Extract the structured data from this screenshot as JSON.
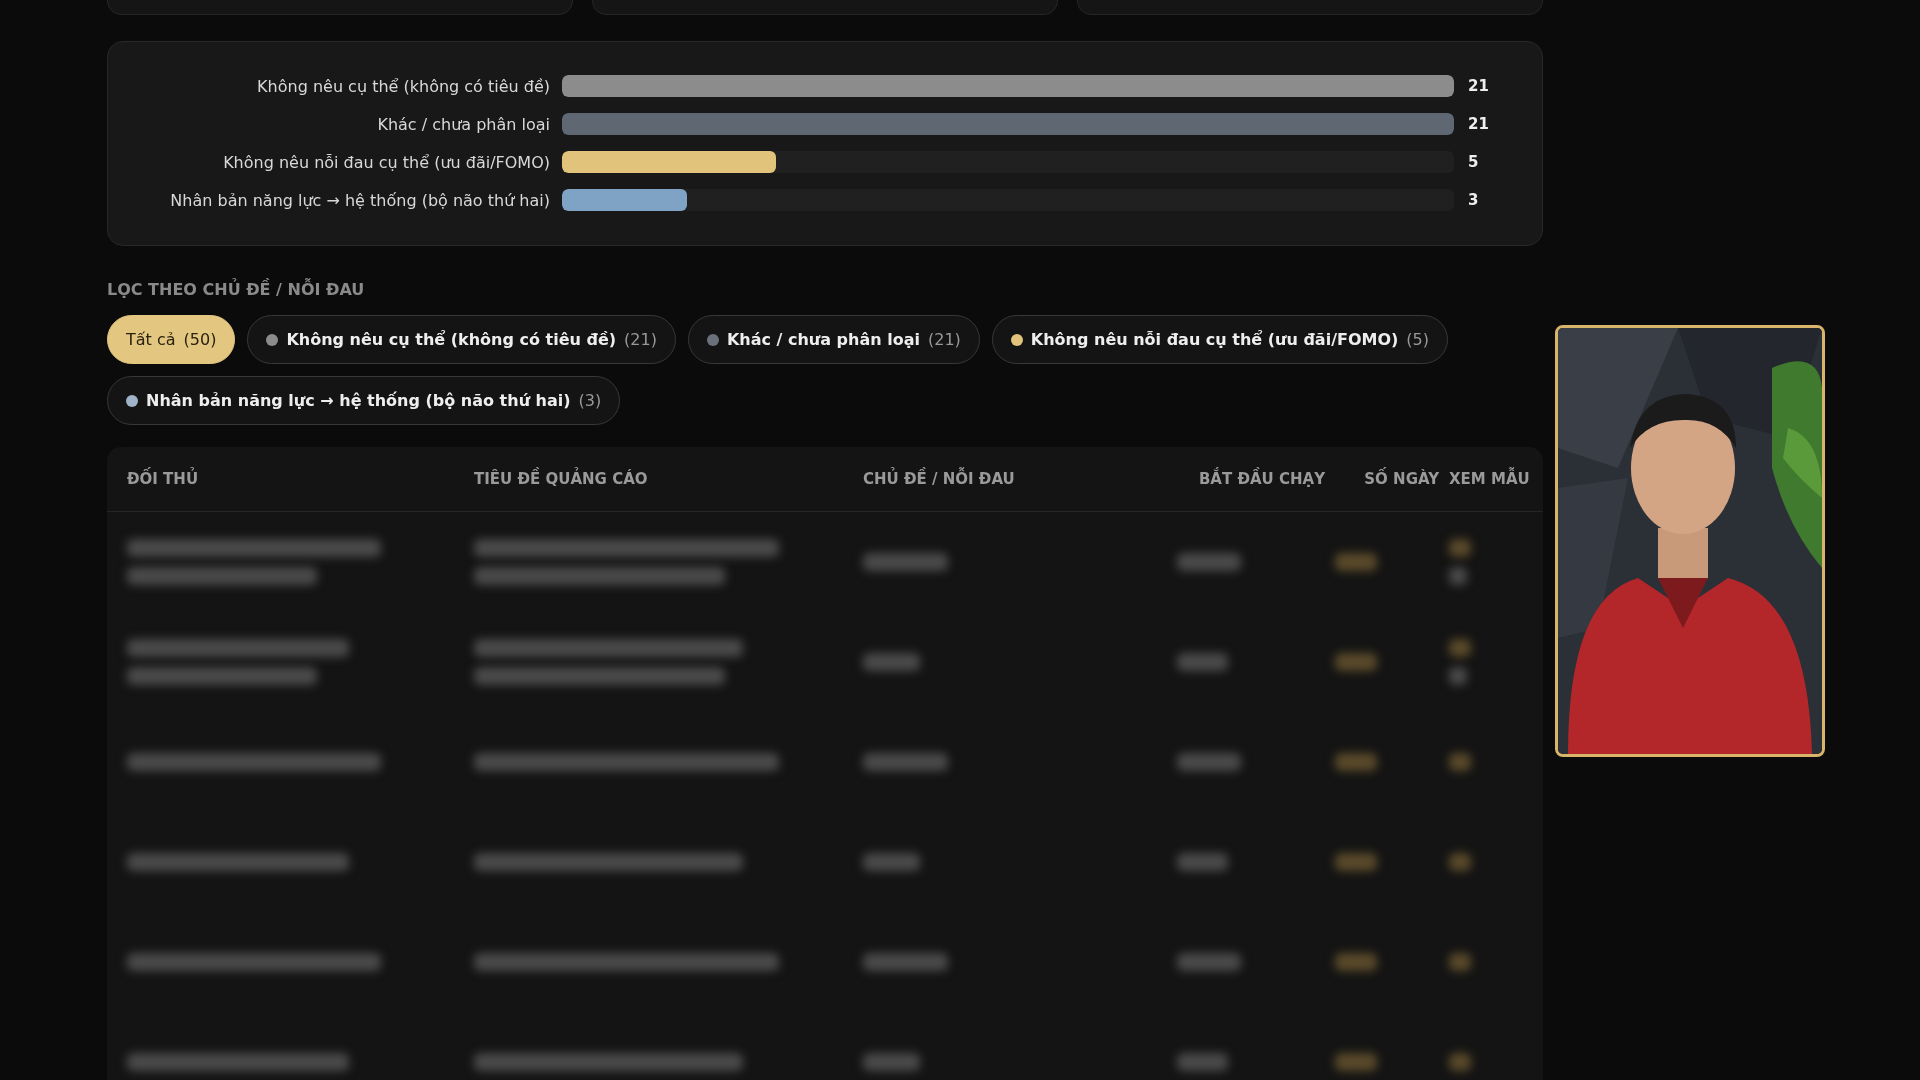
{
  "summary_cards": [
    {
      "kind": "card"
    },
    {
      "kind": "card"
    },
    {
      "kind": "card"
    }
  ],
  "topic_chart": {
    "rows": [
      {
        "label": "Không nêu cụ thể (không có tiêu đề)",
        "level": 1,
        "count": "21",
        "color": "#8c8c8c"
      },
      {
        "label": "Khác / chưa phân loại",
        "level": 1,
        "count": "21",
        "color": "#5f6773"
      },
      {
        "label": "Không nêu nỗi đau cụ thể (ưu đãi/FOMO)",
        "level": 0.24,
        "count": "5",
        "color": "#e2c37c"
      },
      {
        "label": "Nhân bản năng lực → hệ thống (bộ não thứ hai)",
        "level": 0.14,
        "count": "3",
        "color": "#7fa3c4"
      }
    ]
  },
  "filter": {
    "title": "LỌC THEO CHỦ ĐỀ / NỖI ĐAU",
    "chips": [
      {
        "label": "Tất cả",
        "count": "(50)",
        "selected": true
      },
      {
        "label": "Không nêu cụ thể (không có tiêu đề)",
        "count": "(21)",
        "selected": false,
        "color": "#8c8c8c"
      },
      {
        "label": "Khác / chưa phân loại",
        "count": "(21)",
        "selected": false,
        "color": "#6b717a"
      },
      {
        "label": "Không nêu nỗi đau cụ thể (ưu đãi/FOMO)",
        "count": "(5)",
        "selected": false,
        "color": "#e2c37c"
      },
      {
        "label": "Nhân bản năng lực → hệ thống (bộ não thứ hai)",
        "count": "(3)",
        "selected": false,
        "color": "#9fb4c8"
      }
    ]
  },
  "table": {
    "columns": [
      "ĐỐI THỦ",
      "TIÊU ĐỀ QUẢNG CÁO",
      "CHỦ ĐỀ / NỖI ĐAU",
      "BẮT ĐẦU CHẠY",
      "SỐ NGÀY",
      "XEM MẪU"
    ],
    "rows": [
      {
        "kind": "blurred"
      },
      {
        "kind": "blurred"
      },
      {
        "kind": "blurred"
      },
      {
        "kind": "blurred"
      },
      {
        "kind": "blurred"
      },
      {
        "kind": "blurred"
      }
    ]
  }
}
